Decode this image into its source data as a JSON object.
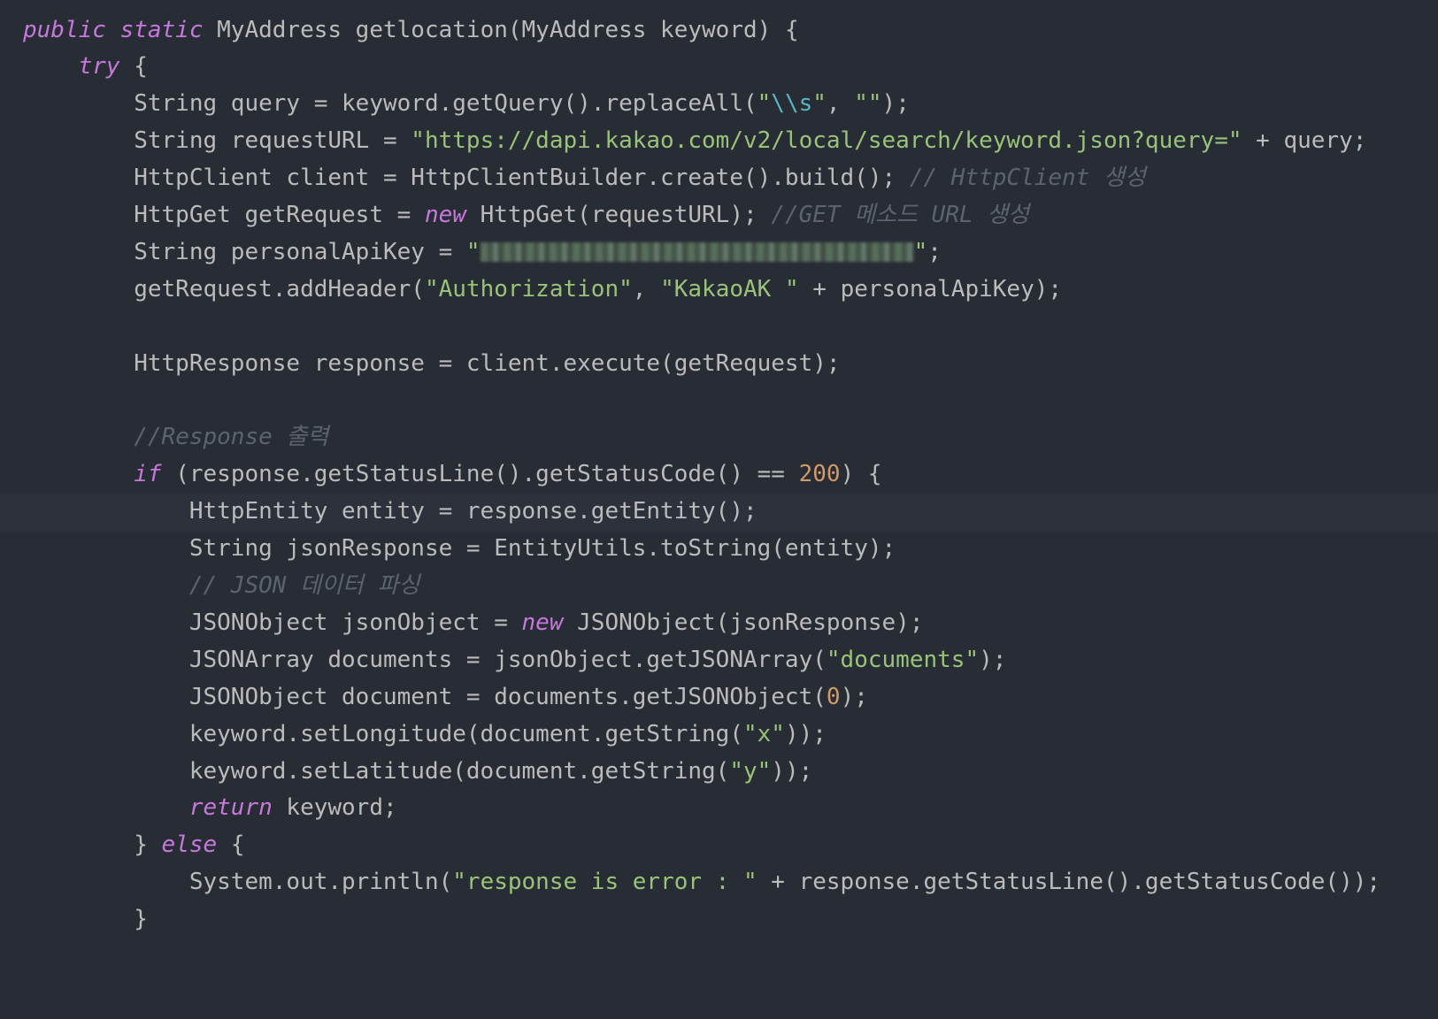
{
  "editor": {
    "theme": "dark",
    "colors": {
      "background": "#282c34",
      "current_line": "#2c313c",
      "keyword": "#c678dd",
      "string": "#98c379",
      "escape": "#56b6c2",
      "number": "#d19a66",
      "comment": "#5c6370",
      "plain": "#bbbbbb"
    },
    "redacted_value_note": "redacted",
    "lines": [
      [
        [
          "kw",
          "public static"
        ],
        [
          "plain",
          " MyAddress getlocation(MyAddress keyword) {"
        ]
      ],
      [
        [
          "plain",
          "    "
        ],
        [
          "kw",
          "try"
        ],
        [
          "plain",
          " {"
        ]
      ],
      [
        [
          "plain",
          "        String query = keyword.getQuery().replaceAll("
        ],
        [
          "str",
          "\""
        ],
        [
          "esc",
          "\\\\s"
        ],
        [
          "str",
          "\""
        ],
        [
          "plain",
          ", "
        ],
        [
          "str",
          "\"\""
        ],
        [
          "plain",
          ");"
        ]
      ],
      [
        [
          "plain",
          "        String requestURL = "
        ],
        [
          "str",
          "\"https://dapi.kakao.com/v2/local/search/keyword.json?query=\""
        ],
        [
          "plain",
          " + query;"
        ]
      ],
      [
        [
          "plain",
          "        HttpClient client = HttpClientBuilder.create().build(); "
        ],
        [
          "cmt",
          "// HttpClient 생성"
        ]
      ],
      [
        [
          "plain",
          "        HttpGet getRequest = "
        ],
        [
          "kw",
          "new"
        ],
        [
          "plain",
          " HttpGet(requestURL); "
        ],
        [
          "cmt",
          "//GET 메소드 URL 생성"
        ]
      ],
      [
        [
          "plain",
          "        String personalApiKey = "
        ],
        [
          "str",
          "\""
        ],
        [
          "blur",
          ""
        ],
        [
          "str",
          "\""
        ],
        [
          "plain",
          ";"
        ]
      ],
      [
        [
          "plain",
          "        getRequest.addHeader("
        ],
        [
          "str",
          "\"Authorization\""
        ],
        [
          "plain",
          ", "
        ],
        [
          "str",
          "\"KakaoAK \""
        ],
        [
          "plain",
          " + personalApiKey);"
        ]
      ],
      [],
      [
        [
          "plain",
          "        HttpResponse response = client.execute(getRequest);"
        ]
      ],
      [],
      [
        [
          "plain",
          "        "
        ],
        [
          "cmt",
          "//Response 출력"
        ]
      ],
      [
        [
          "plain",
          "        "
        ],
        [
          "kw",
          "if"
        ],
        [
          "plain",
          " (response.getStatusLine().getStatusCode() == "
        ],
        [
          "num",
          "200"
        ],
        [
          "plain",
          ") {"
        ]
      ],
      [
        [
          "plain",
          "            HttpEntity entity = response.getEntity();"
        ]
      ],
      [
        [
          "plain",
          "            String jsonResponse = EntityUtils.toString(entity);"
        ]
      ],
      [
        [
          "plain",
          "            "
        ],
        [
          "cmt",
          "// JSON 데이터 파싱"
        ]
      ],
      [
        [
          "plain",
          "            JSONObject jsonObject = "
        ],
        [
          "kw",
          "new"
        ],
        [
          "plain",
          " JSONObject(jsonResponse);"
        ]
      ],
      [
        [
          "plain",
          "            JSONArray documents = jsonObject.getJSONArray("
        ],
        [
          "str",
          "\"documents\""
        ],
        [
          "plain",
          ");"
        ]
      ],
      [
        [
          "plain",
          "            JSONObject document = documents.getJSONObject("
        ],
        [
          "num",
          "0"
        ],
        [
          "plain",
          ");"
        ]
      ],
      [
        [
          "plain",
          "            keyword.setLongitude(document.getString("
        ],
        [
          "str",
          "\"x\""
        ],
        [
          "plain",
          "));"
        ]
      ],
      [
        [
          "plain",
          "            keyword.setLatitude(document.getString("
        ],
        [
          "str",
          "\"y\""
        ],
        [
          "plain",
          "));"
        ]
      ],
      [
        [
          "plain",
          "            "
        ],
        [
          "kw",
          "return"
        ],
        [
          "plain",
          " keyword;"
        ]
      ],
      [
        [
          "plain",
          "        } "
        ],
        [
          "kw",
          "else"
        ],
        [
          "plain",
          " {"
        ]
      ],
      [
        [
          "plain",
          "            System.out.println("
        ],
        [
          "str",
          "\"response is error : \""
        ],
        [
          "plain",
          " + response.getStatusLine().getStatusCode());"
        ]
      ],
      [
        [
          "plain",
          "        }"
        ]
      ]
    ],
    "current_line_index": 13
  }
}
